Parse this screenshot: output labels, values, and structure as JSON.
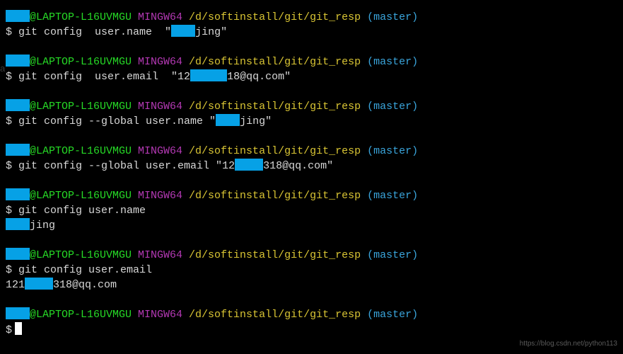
{
  "prompt": {
    "user_redacted_prefix": "",
    "host_suffix": "@LAPTOP-L16UVMGU",
    "shell": " MINGW64 ",
    "path": "/d/softinstall/git/git_resp",
    "branch": " (master)",
    "prompt_symbol": "$ "
  },
  "blocks": [
    {
      "command": "git config  user.name  \"",
      "post_redact": "jing\"",
      "output_plain": null
    },
    {
      "command": "git config  user.email  \"12",
      "post_redact": "18@qq.com\"",
      "output_plain": null
    },
    {
      "command": "git config --global user.name \"",
      "post_redact": "jing\"",
      "output_plain": null
    },
    {
      "command": "git config --global user.email \"12",
      "post_redact": "318@qq.com\"",
      "output_plain": null
    },
    {
      "command": "git config user.name",
      "post_redact": null,
      "output_redacted_suffix": "jing"
    },
    {
      "command": "git config user.email",
      "post_redact": null,
      "output_plain_prefix": "121",
      "output_redacted_suffix": "318@qq.com"
    }
  ],
  "final_empty_prompt_symbol": "$",
  "watermark": "https://blog.csdn.net/python113",
  "left_cut_hint": "a"
}
